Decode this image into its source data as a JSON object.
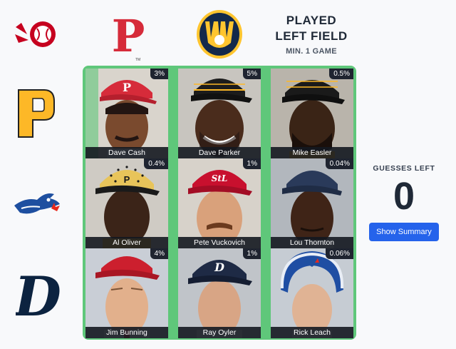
{
  "criteria": {
    "line1": "PLAYED",
    "line2": "LEFT FIELD",
    "line3": "MIN. 1 GAME"
  },
  "logos": {
    "col1": "reds-logo",
    "col2": "phillies-logo",
    "col3": "brewers-logo",
    "row1": "pirates-logo",
    "row2": "blue-jays-logo",
    "row3": "tigers-logo"
  },
  "phillies_mark": "P",
  "tigers_mark": "D",
  "tm": "TM",
  "grid": [
    {
      "name": "Dave Cash",
      "pct": "3%"
    },
    {
      "name": "Dave Parker",
      "pct": "5%"
    },
    {
      "name": "Mike Easler",
      "pct": "0.5%"
    },
    {
      "name": "Al Oliver",
      "pct": "0.4%"
    },
    {
      "name": "Pete Vuckovich",
      "pct": "1%"
    },
    {
      "name": "Lou Thornton",
      "pct": "0.04%"
    },
    {
      "name": "Jim Bunning",
      "pct": "4%"
    },
    {
      "name": "Ray Oyler",
      "pct": "1%"
    },
    {
      "name": "Rick Leach",
      "pct": "0.06%"
    }
  ],
  "guesses": {
    "label": "GUESSES LEFT",
    "count": "0"
  },
  "summary_button": "Show Summary",
  "colors": {
    "board": "#5fc77a",
    "button": "#2563eb",
    "phillies_red": "#d62b3a",
    "pirates_gold": "#fdb827",
    "brewers_navy": "#13294b",
    "jays_blue": "#1e4fa0",
    "tigers_navy": "#0c2340"
  }
}
